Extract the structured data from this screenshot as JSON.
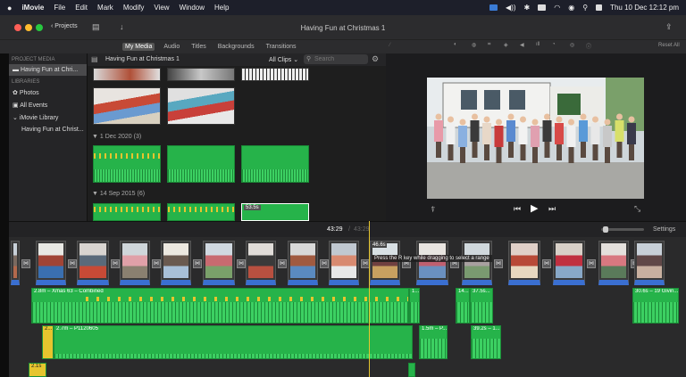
{
  "menubar": {
    "apple": "",
    "app": "iMovie",
    "items": [
      "File",
      "Edit",
      "Mark",
      "Modify",
      "View",
      "Window",
      "Help"
    ],
    "clock": "Thu 10 Dec  12:12 pm"
  },
  "toolbar": {
    "projects_label": "Projects",
    "window_title": "Having Fun at Christmas 1"
  },
  "tabs": [
    "My Media",
    "Audio",
    "Titles",
    "Backgrounds",
    "Transitions"
  ],
  "sidebar": {
    "project_media_header": "PROJECT MEDIA",
    "project_item": "Having Fun at Chri...",
    "libraries_header": "LIBRARIES",
    "items": [
      "Photos",
      "All Events",
      "iMovie Library",
      "Having Fun at Christ..."
    ]
  },
  "browser": {
    "title": "Having Fun at Christmas 1",
    "filter": "All Clips",
    "search_placeholder": "Search",
    "section1": "▼ 1 Dec 2020  (3)",
    "section2": "▼ 14 Sep 2015  (6)",
    "badge": "53.5s"
  },
  "viewer": {
    "reset_all": "Reset All"
  },
  "timeline": {
    "timecode_current": "43:29",
    "timecode_total": "43:29",
    "settings": "Settings",
    "tooltip": "Press the R key while dragging to select a range",
    "clip_badge": "46.6s",
    "audio_labels": {
      "combined": "2.8m – Xmas 63 – Combined",
      "p1120605": "2.7m – P1120605",
      "a1": "1...",
      "a2": "14...",
      "a3": "37.5s...",
      "a4": "30.6s – 19 Givin...",
      "a5": "2...",
      "a6": "1.5m – P...",
      "a7": "39.2s – 1...",
      "a8": "2.1s"
    }
  },
  "colors": {
    "audio_green": "#26b34a",
    "video_blue": "#3a6fd1",
    "playhead": "#e6c52e"
  }
}
